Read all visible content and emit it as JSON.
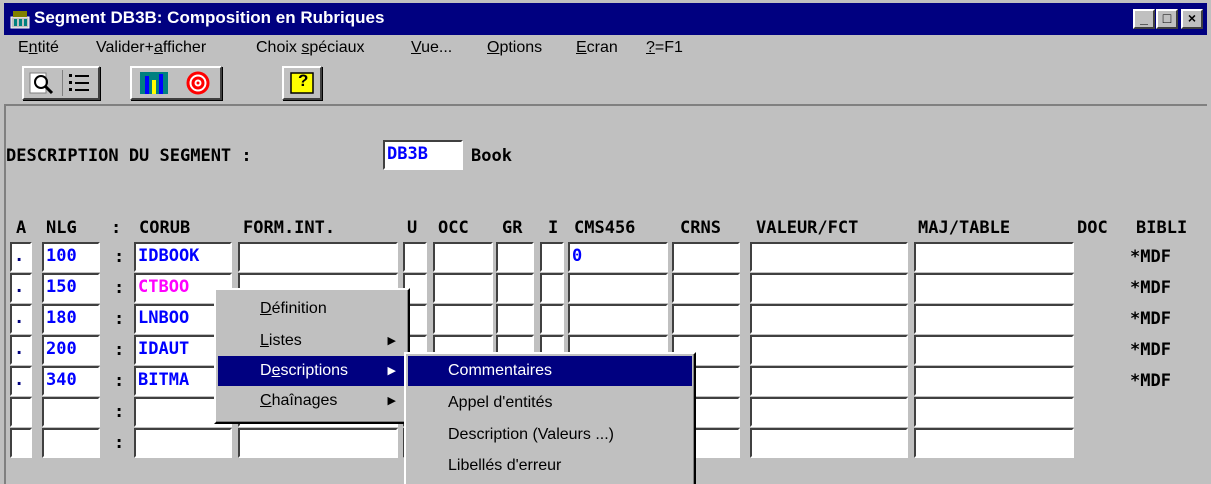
{
  "window": {
    "title": "Segment DB3B: Composition en Rubriques",
    "controls": {
      "minimize": "_",
      "maximize": "□",
      "close": "×"
    }
  },
  "menu": [
    {
      "pre": "E",
      "ul": "n",
      "post": "tité"
    },
    {
      "pre": "Valider+",
      "ul": "a",
      "post": "fficher"
    },
    {
      "pre": "Choix ",
      "ul": "s",
      "post": "péciaux"
    },
    {
      "pre": "",
      "ul": "V",
      "post": "ue..."
    },
    {
      "pre": "",
      "ul": "O",
      "post": "ptions"
    },
    {
      "pre": "",
      "ul": "E",
      "post": "cran"
    },
    {
      "pre": "",
      "ul": "?",
      "post": "=F1"
    }
  ],
  "toolbar": {
    "buttons": [
      "view-icon",
      "list-icon",
      "chart-icon",
      "target-icon",
      "help-icon"
    ],
    "help_glyph": "?"
  },
  "segment": {
    "label": "DESCRIPTION DU SEGMENT  :",
    "code": "DB3B",
    "name": "Book"
  },
  "columns": [
    "A",
    "NLG",
    ":",
    "CORUB",
    "FORM.INT.",
    "U",
    "OCC",
    "GR",
    "I",
    "CMS456",
    "CRNS",
    "VALEUR/FCT",
    "MAJ/TABLE",
    "DOC",
    "BIBLI"
  ],
  "rows": [
    {
      "a": ".",
      "nlg": "100",
      "sep": ":",
      "corub": "IDBOOK",
      "cms": "0",
      "bibli": "*MDF"
    },
    {
      "a": ".",
      "nlg": "150",
      "sep": ":",
      "corub": "CTBOO",
      "cms": "",
      "bibli": "*MDF"
    },
    {
      "a": ".",
      "nlg": "180",
      "sep": ":",
      "corub": "LNBOO",
      "cms": "",
      "bibli": "*MDF"
    },
    {
      "a": ".",
      "nlg": "200",
      "sep": ":",
      "corub": "IDAUT",
      "cms": "",
      "bibli": "*MDF"
    },
    {
      "a": ".",
      "nlg": "340",
      "sep": ":",
      "corub": "BITMA",
      "cms": "",
      "bibli": "*MDF"
    },
    {
      "a": "",
      "nlg": "",
      "sep": ":",
      "corub": "",
      "cms": "",
      "bibli": ""
    },
    {
      "a": "",
      "nlg": "",
      "sep": ":",
      "corub": "",
      "cms": "",
      "bibli": ""
    }
  ],
  "context_menu": [
    {
      "pre": "",
      "ul": "D",
      "post": "éfinition",
      "submenu": false
    },
    {
      "pre": "",
      "ul": "L",
      "post": "istes",
      "submenu": true
    },
    {
      "pre": "D",
      "ul": "e",
      "post": "scriptions",
      "submenu": true
    },
    {
      "pre": "",
      "ul": "C",
      "post": "haînages",
      "submenu": true
    }
  ],
  "submenu": [
    "Commentaires",
    "Appel d'entités",
    "Description (Valeurs ...)",
    "Libellés d'erreur"
  ],
  "colors": {
    "title_bar": "#000080",
    "field_text": "#0000ff",
    "highlight": "#000080",
    "magenta": "#ff00ff"
  }
}
